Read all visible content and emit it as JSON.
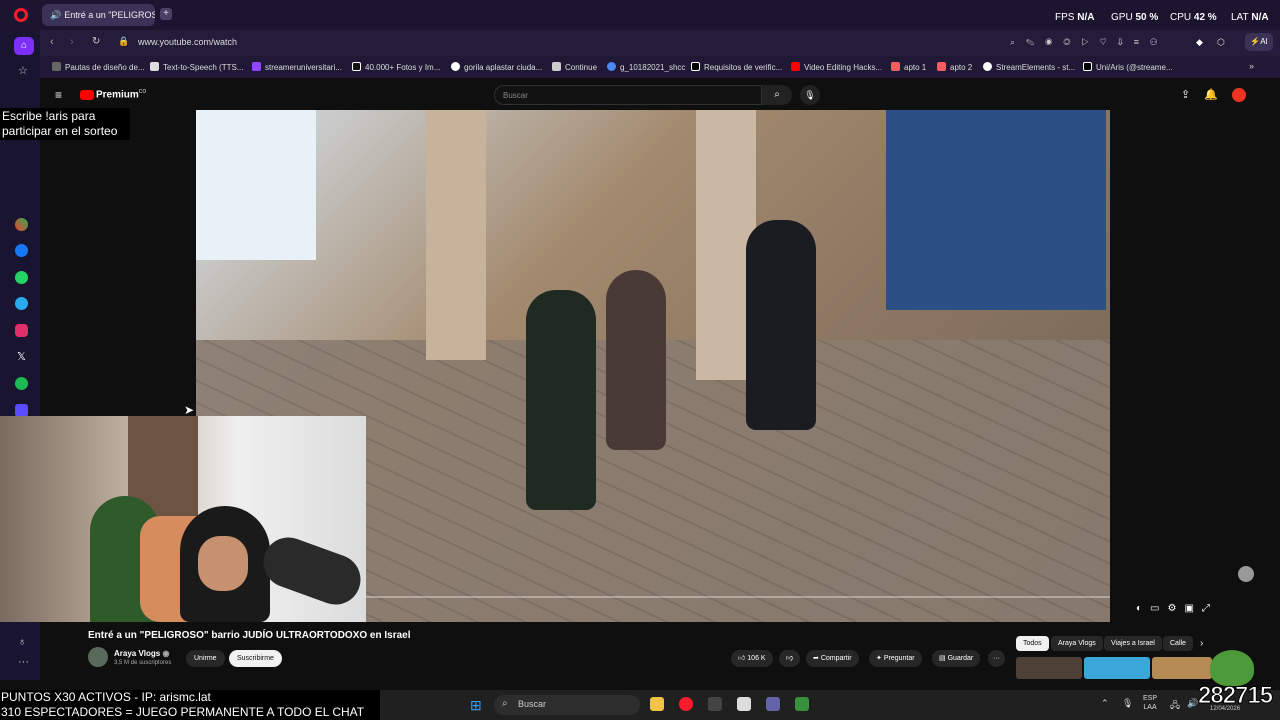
{
  "browser": {
    "tab_title": "Entré a un \"PELIGROSO\" barrio JUDÍO ULTRAORTODOXO en Israel",
    "tab_label_visible": "Entré a un \"PELIGROS",
    "new_tab": "+",
    "url": "www.youtube.com/watch",
    "ai_label": "AI",
    "stats": {
      "fps_label": "FPS",
      "fps_value": "N/A",
      "gpu_label": "GPU",
      "gpu_value": "50 %",
      "cpu_label": "CPU",
      "cpu_value": "42 %",
      "lat_label": "LAT",
      "lat_value": "N/A"
    },
    "bookmarks": [
      "Pautas de diseño de...",
      "Text-to-Speech (TTS...",
      "streameruniversitari...",
      "40.000+ Fotos y Im...",
      "gorila aplastar ciuda...",
      "Continue",
      "g_10182021_shcc",
      "Requisitos de verific...",
      "Video Editing Hacks...",
      "apto 1",
      "apto 2",
      "StreamElements - st...",
      "Uni/Aris (@streame..."
    ]
  },
  "youtube": {
    "logo_text": "Premium",
    "logo_sup": "CO",
    "search_placeholder": "Buscar",
    "video_title": "Entré a un \"PELIGROSO\" barrio JUDÍO ULTRAORTODOXO en Israel",
    "channel_name": "Araya Vlogs",
    "subscribers": "3,5 M de suscriptores",
    "join_label": "Unirme",
    "subscribe_label": "Suscribirme",
    "likes": "106 K",
    "share_label": "Compartir",
    "ask_label": "Preguntar",
    "save_label": "Guardar",
    "more_label": "···",
    "chips": [
      "Todos",
      "Araya Vlogs",
      "Viajes a Israel",
      "Calle"
    ]
  },
  "stream_overlay": {
    "raffle_text": "Escribe !aris para participar en el sorteo",
    "line1": "PUNTOS X30 ACTIVOS - IP: arismc.lat",
    "line2": "310 ESPECTADORES = JUEGO PERMANENTE A TODO EL CHAT",
    "counter": "282715"
  },
  "taskbar": {
    "search_label": "Buscar",
    "lang_top": "ESP",
    "lang_bottom": "LAA",
    "date": "12/04/2026"
  },
  "colors": {
    "opera_red": "#ff1b2d",
    "youtube_red": "#ff0000",
    "frame_purple": "#1b1530"
  }
}
